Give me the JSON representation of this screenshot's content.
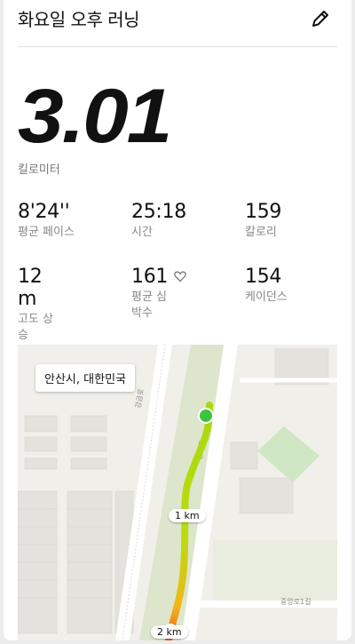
{
  "header": {
    "title": "화요일 오후 러닝",
    "edit_icon": "pencil-icon"
  },
  "distance": {
    "value": "3.01",
    "unit": "킬로미터"
  },
  "stats": [
    {
      "value": "8'24''",
      "label": "평균 페이스"
    },
    {
      "value": "25:18",
      "label": "시간"
    },
    {
      "value": "159",
      "label": "칼로리"
    },
    {
      "value": "12 m",
      "label": "고도 상승"
    },
    {
      "value": "161",
      "label": "평균 심박수",
      "icon": "heart-icon"
    },
    {
      "value": "154",
      "label": "케이던스"
    }
  ],
  "map": {
    "location": "안산시, 대한민국",
    "markers": [
      "1 km",
      "2 km"
    ],
    "street_labels": [
      "강금로",
      "중앙로",
      "중앙로1길"
    ],
    "colors": {
      "route_start": "#a8d810",
      "route_end": "#f05a1e",
      "start_dot": "#3cc43c"
    }
  }
}
